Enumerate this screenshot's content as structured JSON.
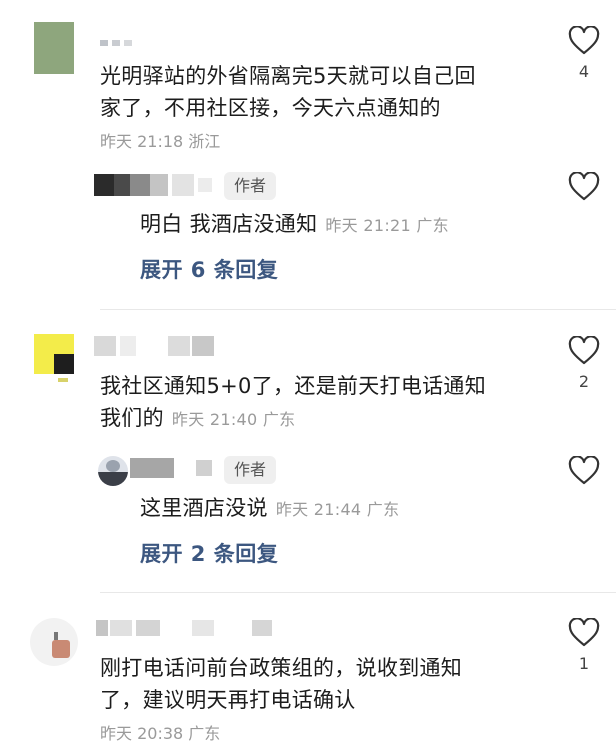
{
  "colors": {
    "link": "#3c5780",
    "meta": "#9a9a9a",
    "text": "#1c1c1c",
    "tag_bg": "#efefef"
  },
  "comments": [
    {
      "text_lines": [
        "光明驿站的外省隔离完5天就可以自己回",
        "家了，不用社区接，今天六点通知的"
      ],
      "meta": "昨天 21:18 浙江",
      "like_count": "4",
      "reply": {
        "tag": "作者",
        "text": "明白 我酒店没通知",
        "meta": "昨天 21:21 广东",
        "expand": "展开 6 条回复"
      }
    },
    {
      "text_lines": [
        "我社区通知5+0了，还是前天打电话通知",
        "我们的"
      ],
      "meta": "昨天 21:40 广东",
      "like_count": "2",
      "reply": {
        "tag": "作者",
        "text": "这里酒店没说",
        "meta": "昨天 21:44 广东",
        "expand": "展开 2 条回复"
      }
    },
    {
      "text_lines": [
        "刚打电话问前台政策组的，说收到通知",
        "了，建议明天再打电话确认"
      ],
      "meta": "昨天 20:38 广东",
      "like_count": "1"
    }
  ]
}
